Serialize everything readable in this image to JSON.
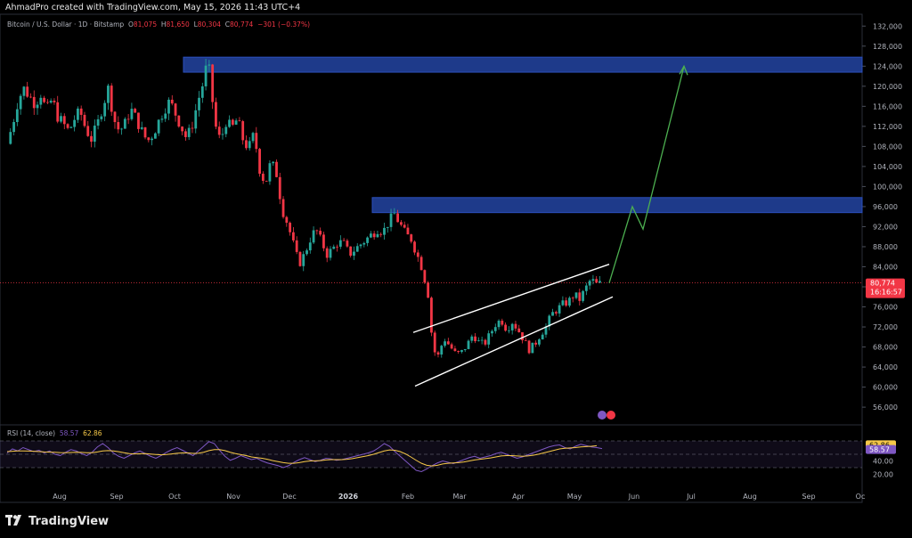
{
  "header": {
    "attribution": "AhmadPro created with TradingView.com, May 15, 2026 11:43 UTC+4"
  },
  "legend": {
    "symbol": "Bitcoin / U.S. Dollar · 1D · Bitstamp",
    "open_label": "O",
    "open": "81,075",
    "high_label": "H",
    "high": "81,650",
    "low_label": "L",
    "low": "80,304",
    "close_label": "C",
    "close": "80,774",
    "change": "−301 (−0.37%)"
  },
  "price_badge": {
    "price": "80,774",
    "countdown": "16:16:57"
  },
  "rsi": {
    "legend": "RSI (14, close)",
    "value": "58.57",
    "ma_value": "62.86",
    "axis_labels": [
      "60.00",
      "40.00",
      "20.00"
    ],
    "badge_ma": "62.86",
    "badge_rsi": "58.57"
  },
  "branding": {
    "logo_text": "TradingView"
  },
  "colors": {
    "up": "#26a69a",
    "down": "#f23645",
    "zone": "#1e3a8a",
    "projection": "#4caf50",
    "rsi": "#7e57c2",
    "rsi_ma": "#f7c948"
  },
  "chart_data": {
    "type": "candlestick",
    "title": "Bitcoin / U.S. Dollar · 1D · Bitstamp",
    "y_ticks": [
      132000,
      128000,
      124000,
      120000,
      116000,
      112000,
      108000,
      104000,
      100000,
      96000,
      92000,
      88000,
      84000,
      80000,
      76000,
      72000,
      68000,
      64000,
      60000,
      56000
    ],
    "y_tick_labels": [
      "132,000",
      "128,000",
      "124,000",
      "120,000",
      "116,000",
      "112,000",
      "108,000",
      "104,000",
      "100,000",
      "96,000",
      "92,000",
      "88,000",
      "84,000",
      "80,000",
      "76,000",
      "72,000",
      "68,000",
      "64,000",
      "60,000",
      "56,000"
    ],
    "ylim": [
      53000,
      134000
    ],
    "x_labels": [
      "Aug",
      "Sep",
      "Oct",
      "Nov",
      "Dec",
      "2026",
      "Feb",
      "Mar",
      "Apr",
      "May",
      "Jun",
      "Jul",
      "Aug",
      "Sep",
      "Oc"
    ],
    "close_series": [
      [
        0,
        108500
      ],
      [
        5,
        112500
      ],
      [
        10,
        117500
      ],
      [
        15,
        119500
      ],
      [
        20,
        118000
      ],
      [
        25,
        116500
      ],
      [
        30,
        118500
      ],
      [
        35,
        115000
      ],
      [
        40,
        117500
      ],
      [
        45,
        114000
      ],
      [
        50,
        112500
      ],
      [
        55,
        111000
      ],
      [
        60,
        113500
      ],
      [
        65,
        115000
      ],
      [
        70,
        111500
      ],
      [
        75,
        109500
      ],
      [
        80,
        112000
      ],
      [
        85,
        116000
      ],
      [
        90,
        119500
      ],
      [
        92,
        117500
      ],
      [
        95,
        113500
      ],
      [
        100,
        111000
      ],
      [
        105,
        112500
      ],
      [
        110,
        115500
      ],
      [
        115,
        113500
      ],
      [
        120,
        111000
      ],
      [
        125,
        109000
      ],
      [
        130,
        110500
      ],
      [
        135,
        113000
      ],
      [
        140,
        115500
      ],
      [
        145,
        117000
      ],
      [
        150,
        114500
      ],
      [
        155,
        112000
      ],
      [
        160,
        109500
      ],
      [
        165,
        112500
      ],
      [
        170,
        117000
      ],
      [
        175,
        121000
      ],
      [
        178,
        124500
      ],
      [
        180,
        123000
      ],
      [
        183,
        117000
      ],
      [
        185,
        112500
      ],
      [
        190,
        109000
      ],
      [
        195,
        113000
      ],
      [
        200,
        111500
      ],
      [
        205,
        113500
      ],
      [
        210,
        109500
      ],
      [
        215,
        107500
      ],
      [
        220,
        110500
      ],
      [
        225,
        103500
      ],
      [
        230,
        100500
      ],
      [
        235,
        105000
      ],
      [
        240,
        102500
      ],
      [
        245,
        95500
      ],
      [
        250,
        92500
      ],
      [
        255,
        88500
      ],
      [
        260,
        84500
      ],
      [
        265,
        86500
      ],
      [
        270,
        89500
      ],
      [
        275,
        91500
      ],
      [
        280,
        89000
      ],
      [
        285,
        86500
      ],
      [
        290,
        87500
      ],
      [
        295,
        89000
      ],
      [
        300,
        88500
      ],
      [
        305,
        86500
      ],
      [
        310,
        87500
      ],
      [
        315,
        88500
      ],
      [
        320,
        89500
      ],
      [
        325,
        90500
      ],
      [
        330,
        91500
      ],
      [
        335,
        91000
      ],
      [
        340,
        93000
      ],
      [
        345,
        94500
      ],
      [
        350,
        92500
      ],
      [
        355,
        90500
      ],
      [
        360,
        89500
      ],
      [
        365,
        86500
      ],
      [
        370,
        83500
      ],
      [
        375,
        78500
      ],
      [
        377,
        72500
      ],
      [
        380,
        68000
      ],
      [
        383,
        65000
      ],
      [
        385,
        67500
      ],
      [
        390,
        69500
      ],
      [
        395,
        68000
      ],
      [
        400,
        66500
      ],
      [
        405,
        67000
      ],
      [
        410,
        68500
      ],
      [
        415,
        70500
      ],
      [
        420,
        69000
      ],
      [
        425,
        68500
      ],
      [
        430,
        70500
      ],
      [
        435,
        72500
      ],
      [
        440,
        73500
      ],
      [
        445,
        71500
      ],
      [
        450,
        73000
      ],
      [
        455,
        71500
      ],
      [
        460,
        69500
      ],
      [
        465,
        67500
      ],
      [
        470,
        68500
      ],
      [
        475,
        70500
      ],
      [
        480,
        72000
      ],
      [
        485,
        74500
      ],
      [
        490,
        75500
      ],
      [
        495,
        76500
      ],
      [
        500,
        77000
      ],
      [
        505,
        78500
      ],
      [
        510,
        77500
      ],
      [
        515,
        79500
      ],
      [
        520,
        81500
      ],
      [
        525,
        80500
      ],
      [
        530,
        80774
      ]
    ],
    "supply_zones": [
      {
        "from": 122800,
        "to": 125800
      },
      {
        "from": 94800,
        "to": 97800
      }
    ],
    "rising_wedge": {
      "upper": [
        [
          70900,
          "Feb"
        ],
        [
          84500,
          "May"
        ]
      ],
      "lower": [
        [
          60200,
          "Feb"
        ],
        [
          78000,
          "May"
        ]
      ]
    },
    "projection_path": [
      80774,
      96000,
      91500,
      124000
    ],
    "rsi_series": [
      52,
      58,
      55,
      60,
      57,
      54,
      56,
      52,
      55,
      50,
      48,
      53,
      57,
      55,
      51,
      48,
      53,
      61,
      66,
      60,
      52,
      47,
      44,
      48,
      52,
      55,
      51,
      47,
      44,
      48,
      53,
      57,
      60,
      56,
      52,
      48,
      55,
      62,
      69,
      66,
      56,
      47,
      41,
      44,
      48,
      45,
      42,
      44,
      40,
      37,
      35,
      33,
      30,
      33,
      38,
      42,
      45,
      42,
      39,
      41,
      44,
      43,
      41,
      42,
      44,
      46,
      48,
      50,
      52,
      55,
      60,
      66,
      62,
      54,
      47,
      40,
      33,
      26,
      24,
      28,
      33,
      37,
      40,
      38,
      36,
      39,
      42,
      45,
      47,
      44,
      46,
      48,
      51,
      53,
      50,
      47,
      44,
      46,
      49,
      52,
      55,
      58,
      61,
      63,
      64,
      60,
      58,
      62,
      65,
      63,
      61,
      60,
      58.57
    ],
    "rsi_ma_series": [
      54,
      54.5,
      55,
      55,
      54.8,
      54.5,
      54,
      53.5,
      53.2,
      53,
      52.5,
      52.3,
      52.6,
      53,
      52.8,
      52.4,
      52.3,
      53.5,
      55,
      55.5,
      55,
      53.8,
      52.3,
      51,
      50.5,
      50.8,
      51,
      50.4,
      49.6,
      49.2,
      49.6,
      50.5,
      51.5,
      52,
      52,
      51.3,
      51.5,
      53,
      55.5,
      57,
      57,
      55.5,
      53,
      51,
      49.5,
      48,
      46,
      45,
      44,
      42.5,
      40.5,
      39,
      37.5,
      36.5,
      36.5,
      37.5,
      39,
      40,
      40.2,
      40.5,
      41.5,
      42,
      42,
      42,
      42.5,
      43.5,
      45,
      46.5,
      48,
      50,
      52.5,
      55,
      56.5,
      56,
      54,
      50.5,
      46,
      41,
      36.5,
      33.5,
      32.5,
      33.5,
      35.5,
      36.5,
      37,
      37.5,
      38.5,
      40,
      41.5,
      42.5,
      43.5,
      44.5,
      46,
      47.5,
      48,
      48,
      47.5,
      47,
      47.5,
      48.5,
      50,
      52,
      54,
      56,
      58,
      59,
      59.5,
      60,
      61,
      61.5,
      62,
      62.86
    ]
  }
}
